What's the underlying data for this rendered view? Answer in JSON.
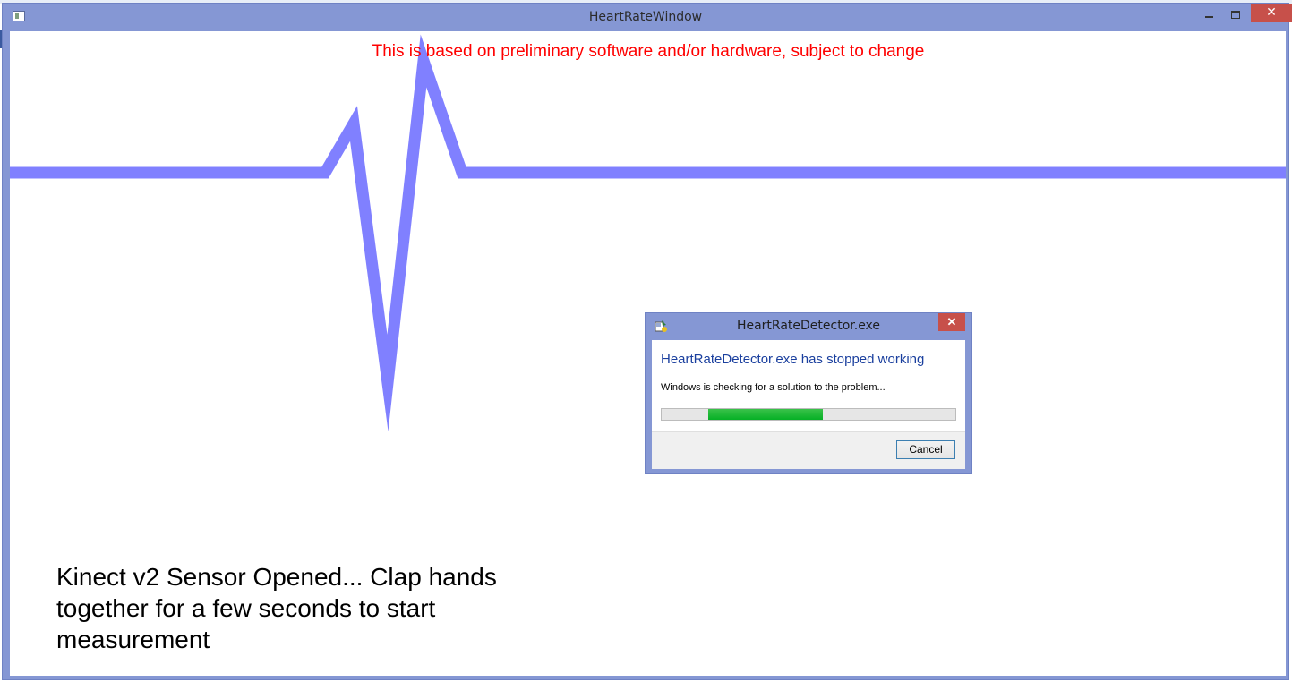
{
  "window": {
    "title": "HeartRateWindow",
    "close_glyph": "✕"
  },
  "notice": {
    "text": "This is based on preliminary software and/or hardware, subject to change",
    "color": "#ff0000"
  },
  "waveform": {
    "color": "#8080ff"
  },
  "status": {
    "message": "Kinect v2 Sensor Opened... Clap hands together for a few seconds to start measurement"
  },
  "dialog": {
    "title": "HeartRateDetector.exe",
    "heading": "HeartRateDetector.exe has stopped working",
    "message": "Windows is checking for a solution to the problem...",
    "close_glyph": "✕",
    "progress": {
      "state": "marquee",
      "color": "#06b025"
    },
    "cancel_label": "Cancel"
  },
  "icons": {
    "app": "window-app-icon",
    "dialog": "program-error-icon"
  }
}
